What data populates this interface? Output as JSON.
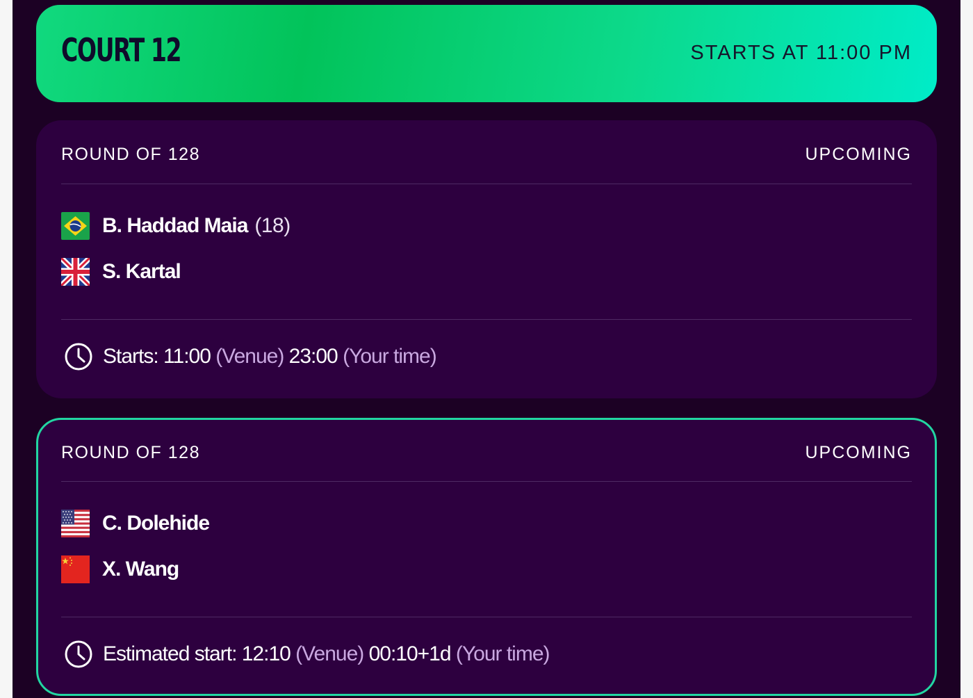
{
  "court": {
    "title": "COURT 12",
    "starts_at": "STARTS AT 11:00 PM"
  },
  "matches": [
    {
      "round": "ROUND OF 128",
      "status": "UPCOMING",
      "highlighted": false,
      "players": [
        {
          "name": "B. Haddad Maia",
          "seed": "(18)",
          "flag": "brazil-flag-icon"
        },
        {
          "name": "S. Kartal",
          "seed": "",
          "flag": "uk-flag-icon"
        }
      ],
      "time": {
        "prefix": "Starts:",
        "venue_time": "11:00",
        "venue_label": "(Venue)",
        "local_time": "23:00",
        "local_label": "(Your time)"
      }
    },
    {
      "round": "ROUND OF 128",
      "status": "UPCOMING",
      "highlighted": true,
      "players": [
        {
          "name": "C. Dolehide",
          "seed": "",
          "flag": "usa-flag-icon"
        },
        {
          "name": "X. Wang",
          "seed": "",
          "flag": "china-flag-icon"
        }
      ],
      "time": {
        "prefix": "Estimated start:",
        "venue_time": "12:10",
        "venue_label": "(Venue)",
        "local_time": "00:10+1d",
        "local_label": "(Your time)"
      }
    }
  ],
  "colors": {
    "background": "#1c0124",
    "card": "#2d003f",
    "accent_green": "#02c35a",
    "accent_teal": "#00ecc8",
    "highlight_border": "#22d6a2",
    "muted_text": "#c9a8e0"
  }
}
